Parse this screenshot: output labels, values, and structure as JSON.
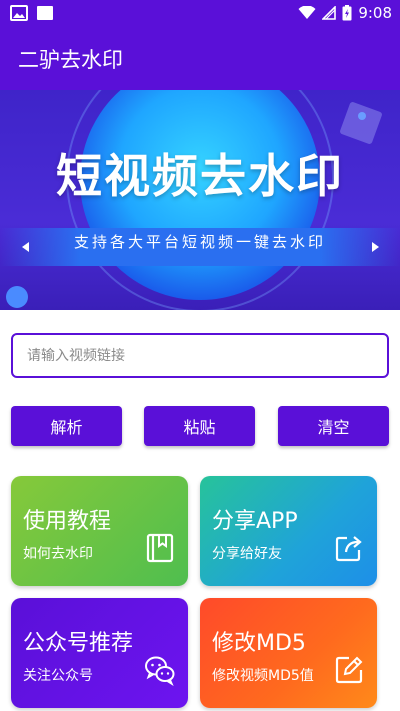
{
  "status_bar": {
    "time": "9:08"
  },
  "app_bar": {
    "title": "二驴去水印"
  },
  "banner": {
    "title": "短视频去水印",
    "subtitle": "支持各大平台短视频一键去水印"
  },
  "url_input": {
    "placeholder": "请输入视频链接",
    "value": ""
  },
  "actions": {
    "parse_label": "解析",
    "paste_label": "粘贴",
    "clear_label": "清空"
  },
  "cards": {
    "tutorial": {
      "title": "使用教程",
      "subtitle": "如何去水印",
      "icon": "book-icon"
    },
    "share": {
      "title": "分享APP",
      "subtitle": "分享给好友",
      "icon": "share-icon"
    },
    "wechat": {
      "title": "公众号推荐",
      "subtitle": "关注公众号",
      "icon": "wechat-icon"
    },
    "md5": {
      "title": "修改MD5",
      "subtitle": "修改视频MD5值",
      "icon": "edit-icon"
    }
  },
  "colors": {
    "primary": "#5a10d8",
    "tutorial_card": "#6cc442",
    "share_card": "#1fa3d9",
    "wechat_card": "#6310e6",
    "md5_card": "#ff6a1e"
  }
}
